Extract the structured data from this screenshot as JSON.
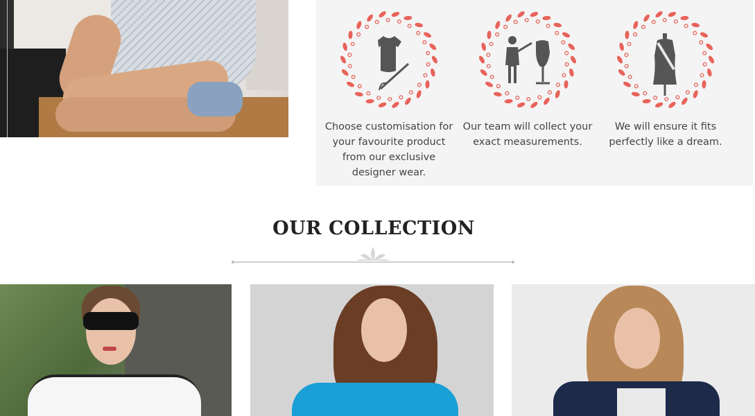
{
  "steps": [
    {
      "icon": "tshirt-needle-icon",
      "text": "Choose customisation for your favourite product from our exclusive designer wear."
    },
    {
      "icon": "tailor-mannequin-icon",
      "text": "Our team will collect your exact measurements."
    },
    {
      "icon": "dress-form-icon",
      "text": "We will ensure it fits perfectly like a dream."
    }
  ],
  "collection": {
    "title": "OUR COLLECTION",
    "products": [
      {
        "name": "product-card-1"
      },
      {
        "name": "product-card-2"
      },
      {
        "name": "product-card-3"
      }
    ]
  },
  "colors": {
    "accent": "#e8635a",
    "panel": "#f4f4f4",
    "icon": "#555555"
  }
}
